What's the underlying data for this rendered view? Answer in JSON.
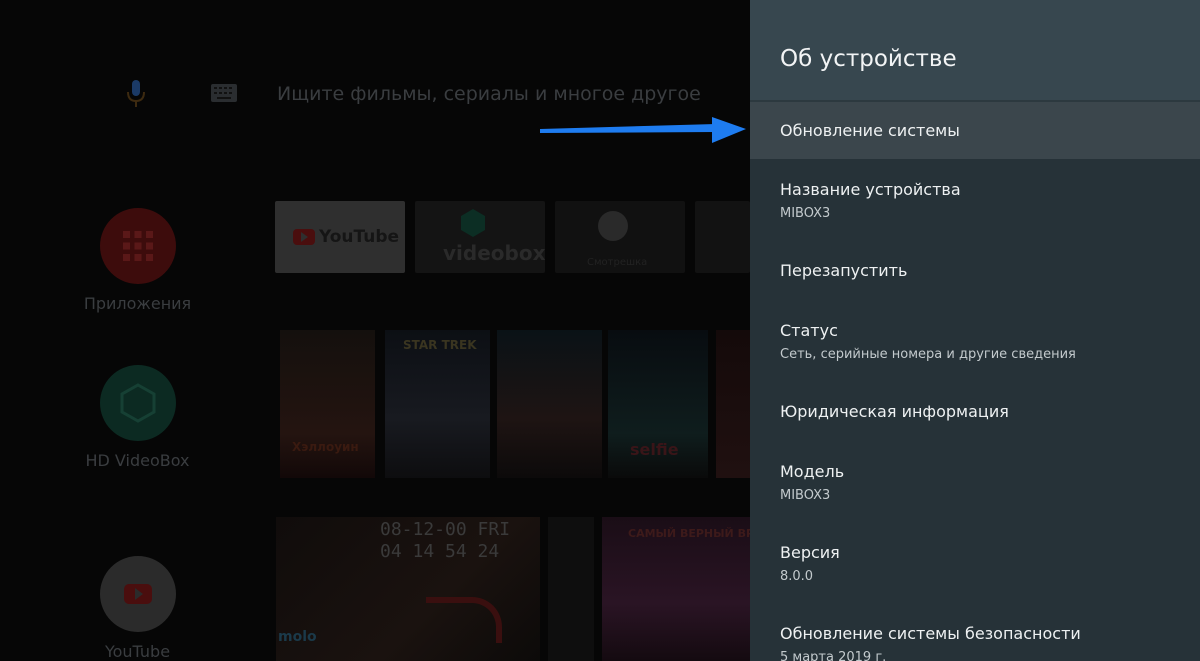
{
  "launcher": {
    "search_placeholder": "Ищите фильмы, сериалы и многое другое",
    "side_apps": [
      {
        "label": "Приложения"
      },
      {
        "label": "HD VideoBox"
      },
      {
        "label": "YouTube"
      }
    ],
    "app_tiles": [
      {
        "label": "YouTube"
      },
      {
        "label": "videobox"
      },
      {
        "label": "Смотрешка"
      }
    ],
    "posters": [
      {
        "title": "Хэллоуин"
      },
      {
        "title": "STAR TREK"
      },
      {
        "title": ""
      },
      {
        "title": "selfie"
      },
      {
        "title": ""
      }
    ],
    "wide_cards": [
      {
        "line1": "08-12-00 FRI",
        "line2": "04 14 54 24",
        "badge": "molo"
      },
      {
        "title": "САМЫЙ ВЕРНЫЙ ВРАГ"
      }
    ]
  },
  "panel": {
    "title": "Об устройстве",
    "items": [
      {
        "title": "Обновление системы",
        "focused": true
      },
      {
        "title": "Название устройства",
        "subtitle": "MIBOX3"
      },
      {
        "title": "Перезапустить"
      },
      {
        "title": "Статус",
        "subtitle": "Сеть, серийные номера и другие сведения"
      },
      {
        "title": "Юридическая информация"
      },
      {
        "title": "Модель",
        "subtitle": "MIBOX3"
      },
      {
        "title": "Версия",
        "subtitle": "8.0.0"
      },
      {
        "title": "Обновление системы безопасности",
        "subtitle": "5 марта 2019 г."
      }
    ]
  },
  "colors": {
    "panel_bg": "#263238",
    "panel_header_bg": "#37474f",
    "focused_item_bg": "#3b464c",
    "annotation_arrow": "#1e7cf0"
  }
}
